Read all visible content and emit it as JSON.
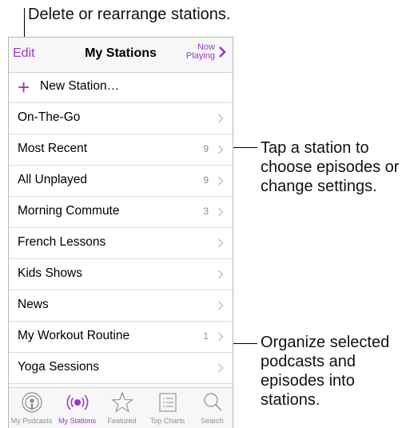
{
  "callouts": {
    "top": "Delete or rearrange stations.",
    "station_line1": "Tap a station to",
    "station_line2": "choose episodes or",
    "station_line3": "change settings.",
    "organize_line1": "Organize selected",
    "organize_line2": "podcasts and",
    "organize_line3": "episodes into",
    "organize_line4": "stations."
  },
  "navbar": {
    "edit": "Edit",
    "title": "My Stations",
    "now_playing_line1": "Now",
    "now_playing_line2": "Playing"
  },
  "new_station": {
    "icon": "plus-icon",
    "label": "New Station…"
  },
  "stations": [
    {
      "label": "On-The-Go",
      "count": ""
    },
    {
      "label": "Most Recent",
      "count": "9"
    },
    {
      "label": "All Unplayed",
      "count": "9"
    },
    {
      "label": "Morning Commute",
      "count": "3"
    },
    {
      "label": "French Lessons",
      "count": ""
    },
    {
      "label": "Kids Shows",
      "count": ""
    },
    {
      "label": "News",
      "count": ""
    },
    {
      "label": "My Workout Routine",
      "count": "1"
    },
    {
      "label": "Yoga Sessions",
      "count": ""
    }
  ],
  "tabbar": [
    {
      "label": "My Podcasts",
      "icon": "podcast-icon",
      "active": false
    },
    {
      "label": "My Stations",
      "icon": "broadcast-icon",
      "active": true
    },
    {
      "label": "Featured",
      "icon": "star-icon",
      "active": false
    },
    {
      "label": "Top Charts",
      "icon": "list-icon",
      "active": false
    },
    {
      "label": "Search",
      "icon": "search-icon",
      "active": false
    }
  ],
  "colors": {
    "accent": "#9b38c9",
    "secondary_text": "#8e8e93"
  }
}
